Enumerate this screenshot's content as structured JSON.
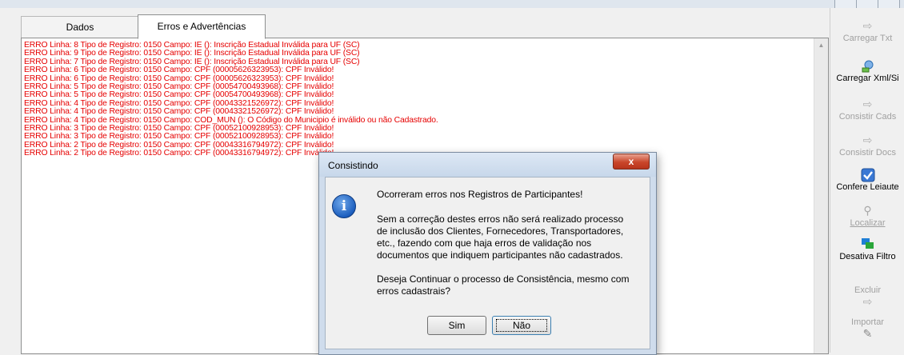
{
  "tabs": [
    {
      "label": "Dados"
    },
    {
      "label": "Erros e Advertências"
    }
  ],
  "log_lines": [
    "ERRO Linha: 8 Tipo de Registro: 0150 Campo: IE (): Inscrição Estadual Inválida para UF (SC)",
    "ERRO Linha: 9 Tipo de Registro: 0150 Campo: IE (): Inscrição Estadual Inválida para UF (SC)",
    "ERRO Linha: 7 Tipo de Registro: 0150 Campo: IE (): Inscrição Estadual Inválida para UF (SC)",
    "ERRO Linha: 6 Tipo de Registro: 0150 Campo: CPF (00005626323953): CPF Inválido!",
    "ERRO Linha: 6 Tipo de Registro: 0150 Campo: CPF (00005626323953): CPF Inválido!",
    "ERRO Linha: 5 Tipo de Registro: 0150 Campo: CPF (00054700493968): CPF Inválido!",
    "ERRO Linha: 5 Tipo de Registro: 0150 Campo: CPF (00054700493968): CPF Inválido!",
    "ERRO Linha: 4 Tipo de Registro: 0150 Campo: CPF (00043321526972): CPF Inválido!",
    "ERRO Linha: 4 Tipo de Registro: 0150 Campo: CPF (00043321526972): CPF Inválido!",
    "ERRO Linha: 4 Tipo de Registro: 0150 Campo: COD_MUN (): O Código do Municipio é inválido ou não Cadastrado.",
    "ERRO Linha: 3 Tipo de Registro: 0150 Campo: CPF (00052100928953): CPF Inválido!",
    "ERRO Linha: 3 Tipo de Registro: 0150 Campo: CPF (00052100928953): CPF Inválido!",
    "ERRO Linha: 2 Tipo de Registro: 0150 Campo: CPF (00043316794972): CPF Inválido!",
    "ERRO Linha: 2 Tipo de Registro: 0150 Campo: CPF (00043316794972): CPF Inválido!"
  ],
  "sidebar": {
    "items": [
      {
        "label": "Carregar Txt",
        "icon": "load-txt-icon",
        "enabled": false
      },
      {
        "label": "Carregar Xml/Si",
        "icon": "load-xml-icon",
        "enabled": true
      },
      {
        "label": "Consistir Cads",
        "icon": "arrow-right-icon",
        "enabled": false
      },
      {
        "label": "Consistir Docs",
        "icon": "arrow-right-icon",
        "enabled": false
      },
      {
        "label": "Confere Leiaute",
        "icon": "checkbox-icon",
        "enabled": true
      },
      {
        "label": "Localizar",
        "icon": "search-icon",
        "enabled": false
      },
      {
        "label": "Desativa Filtro",
        "icon": "filter-icon",
        "enabled": true
      },
      {
        "label": "Excluir",
        "icon": "delete-icon",
        "enabled": false
      },
      {
        "label": "Importar",
        "icon": "import-icon",
        "enabled": false
      }
    ]
  },
  "dialog": {
    "title": "Consistindo",
    "close_glyph": "x",
    "message_title": "Ocorreram erros nos Registros de Participantes!",
    "message_body": [
      "Sem a correção destes erros não será realizado processo",
      "de inclusão dos Clientes, Fornecedores, Transportadores,",
      "etc., fazendo com que haja erros de validação nos",
      "documentos que indiquem participantes não cadastrados."
    ],
    "question": [
      "Deseja Continuar o processo de Consistência, mesmo com",
      "erros cadastrais?"
    ],
    "yes_label": "Sim",
    "no_label": "Não"
  },
  "colors": {
    "error_text": "#e60000",
    "dialog_frame": "#cfdcec",
    "info_icon": "#1d5fbf"
  }
}
